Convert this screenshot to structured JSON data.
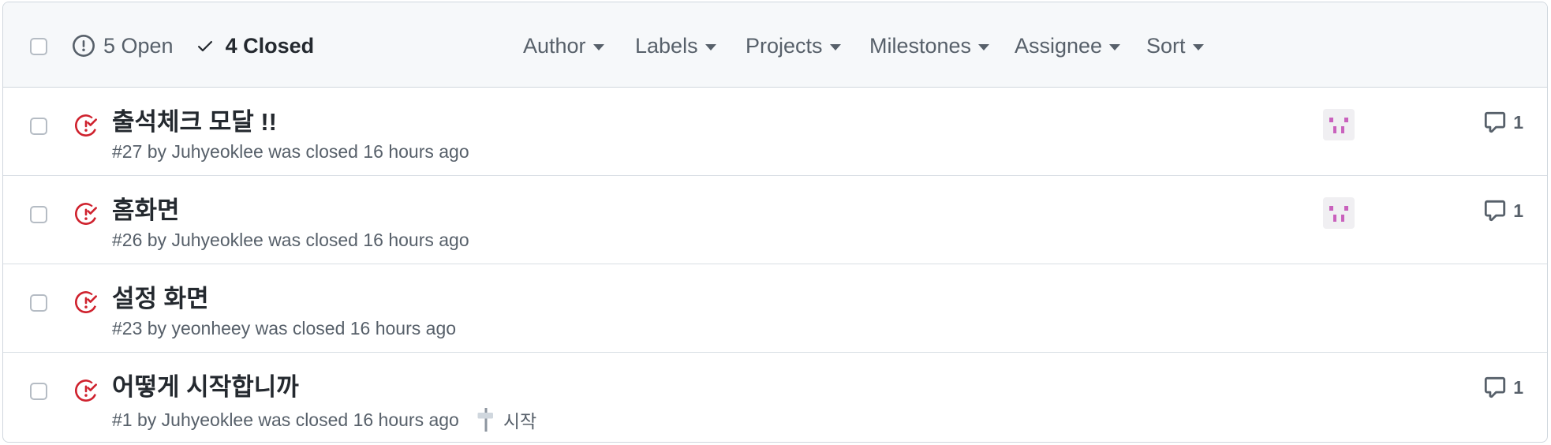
{
  "filters": {
    "open_label": "5 Open",
    "closed_label": "4 Closed",
    "author": "Author",
    "labels": "Labels",
    "projects": "Projects",
    "milestones": "Milestones",
    "assignee": "Assignee",
    "sort": "Sort"
  },
  "colors": {
    "closed_icon": "#cf222e",
    "avatar_pink": "#c961bd",
    "header_bg": "#f6f8fa"
  },
  "issues": [
    {
      "title": "출석체크 모달 !!",
      "meta": "#27 by Juhyeoklee was closed 16 hours ago",
      "assignee_avatar": true,
      "comments": "1"
    },
    {
      "title": "홈화면",
      "meta": "#26 by Juhyeoklee was closed 16 hours ago",
      "assignee_avatar": true,
      "comments": "1"
    },
    {
      "title": "설정 화면",
      "meta": "#23 by yeonheey was closed 16 hours ago",
      "assignee_avatar": false,
      "comments": ""
    },
    {
      "title": "어떻게 시작합니까",
      "meta": "#1 by Juhyeoklee was closed 16 hours ago",
      "milestone": "시작",
      "assignee_avatar": false,
      "comments": "1"
    }
  ]
}
